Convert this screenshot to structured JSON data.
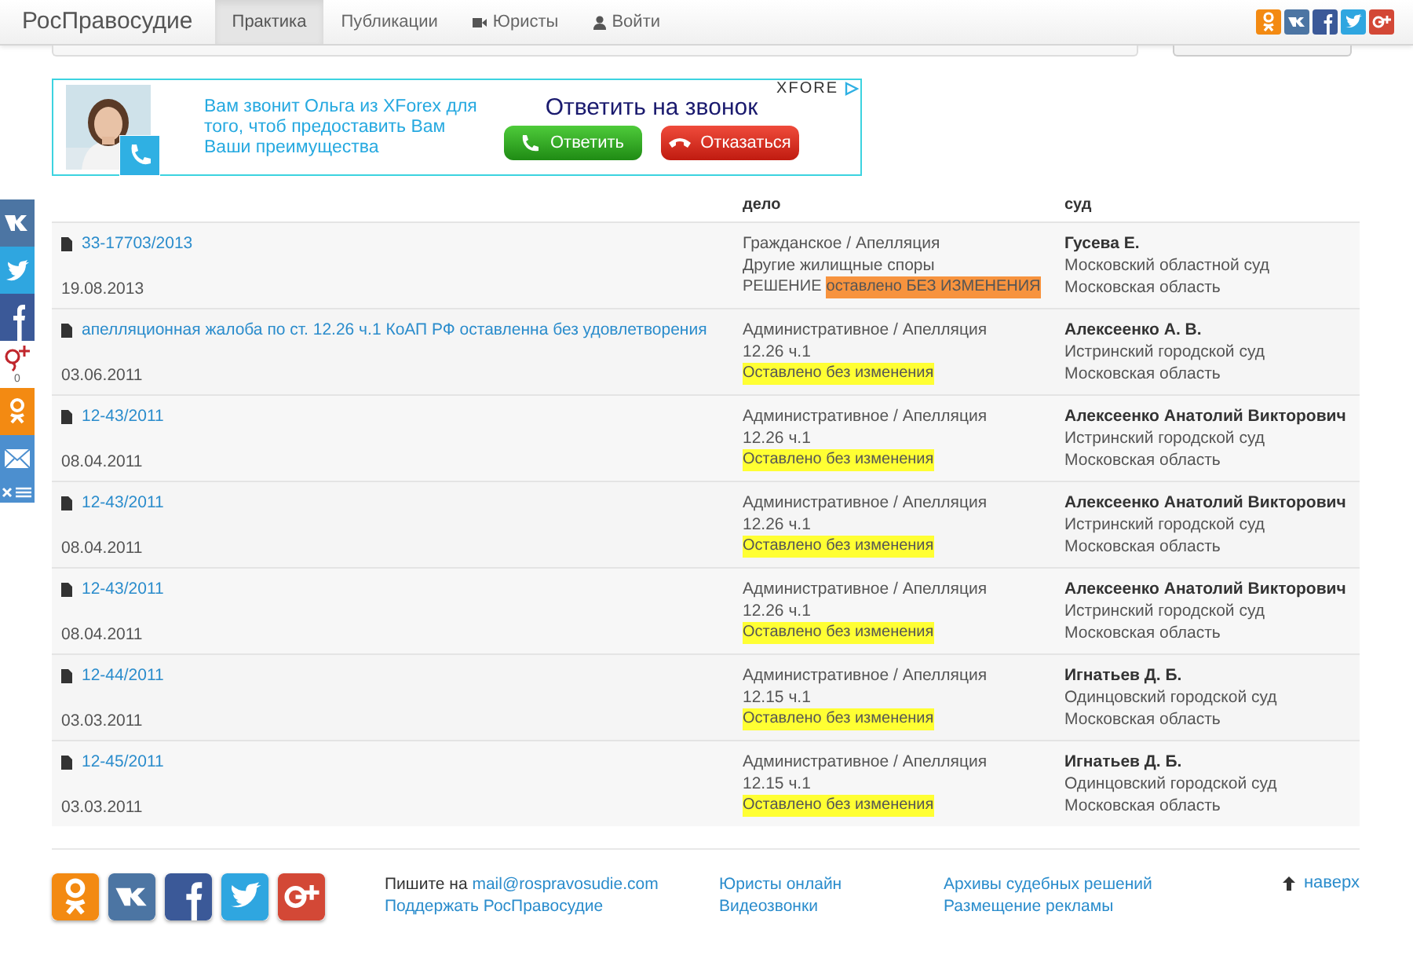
{
  "brand": "РосПравосудие",
  "nav": {
    "tabs": [
      {
        "label": "Практика",
        "selected": true
      },
      {
        "label": "Публикации",
        "selected": false
      },
      {
        "label": "Юристы",
        "selected": false,
        "kind": "camera"
      },
      {
        "label": "Войти",
        "selected": false,
        "kind": "person"
      }
    ]
  },
  "ad": {
    "message": "Вам звонит Ольга из XForex для того, чтоб предоставить Вам Ваши преимущества",
    "heading": "Ответить на звонок",
    "accept": "Ответить",
    "decline": "Отказаться",
    "logo": "XFORE"
  },
  "share": {
    "gplus_count": "0"
  },
  "table": {
    "columns": [
      "дело",
      "суд"
    ],
    "rows": [
      {
        "case": "33-17703/2013",
        "date": "19.08.2013",
        "type": "Гражданское / Апелляция",
        "article": "Другие жилищные споры",
        "decision_prefix": "РЕШЕНИЕ",
        "decision": "оставлено БЕЗ ИЗМЕНЕНИЯ",
        "color": "#f7933e",
        "judge": "Гусева Е.",
        "court": "Московский областной суд",
        "region": "Московская область"
      },
      {
        "case": "апелляционная жалоба по ст. 12.26 ч.1 КоАП РФ оставленна без удовлетворения",
        "date": "03.06.2011",
        "type": "Административное / Апелляция",
        "article": "12.26 ч.1",
        "decision": "Оставлено без изменения",
        "color": "#ffff33",
        "judge": "Алексеенко А. В.",
        "court": "Истринский городской суд",
        "region": "Московская область"
      },
      {
        "case": "12-43/2011",
        "date": "08.04.2011",
        "type": "Административное / Апелляция",
        "article": "12.26 ч.1",
        "decision": "Оставлено без изменения",
        "color": "#ffff33",
        "judge": "Алексеенко Анатолий Викторович",
        "court": "Истринский городской суд",
        "region": "Московская область"
      },
      {
        "case": "12-43/2011",
        "date": "08.04.2011",
        "type": "Административное / Апелляция",
        "article": "12.26 ч.1",
        "decision": "Оставлено без изменения",
        "color": "#ffff33",
        "judge": "Алексеенко Анатолий Викторович",
        "court": "Истринский городской суд",
        "region": "Московская область"
      },
      {
        "case": "12-43/2011",
        "date": "08.04.2011",
        "type": "Административное / Апелляция",
        "article": "12.26 ч.1",
        "decision": "Оставлено без изменения",
        "color": "#ffff33",
        "judge": "Алексеенко Анатолий Викторович",
        "court": "Истринский городской суд",
        "region": "Московская область"
      },
      {
        "case": "12-44/2011",
        "date": "03.03.2011",
        "type": "Административное / Апелляция",
        "article": "12.15 ч.1",
        "decision": "Оставлено без изменения",
        "color": "#ffff33",
        "judge": "Игнатьев Д. Б.",
        "court": "Одинцовский городской суд",
        "region": "Московская область"
      },
      {
        "case": "12-45/2011",
        "date": "03.03.2011",
        "type": "Административное / Апелляция",
        "article": "12.15 ч.1",
        "decision": "Оставлено без изменения",
        "color": "#ffff33",
        "judge": "Игнатьев Д. Б.",
        "court": "Одинцовский городской суд",
        "region": "Московская область"
      }
    ]
  },
  "footer": {
    "write_prefix": "Пишите на",
    "email": "mail@rospravosudie.com",
    "support": "Поддержать РосПравосудие",
    "links": [
      [
        "Юристы онлайн",
        "Видеозвонки"
      ],
      [
        "Архивы судебных решений",
        "Размещение рекламы"
      ]
    ],
    "top": "наверх"
  }
}
